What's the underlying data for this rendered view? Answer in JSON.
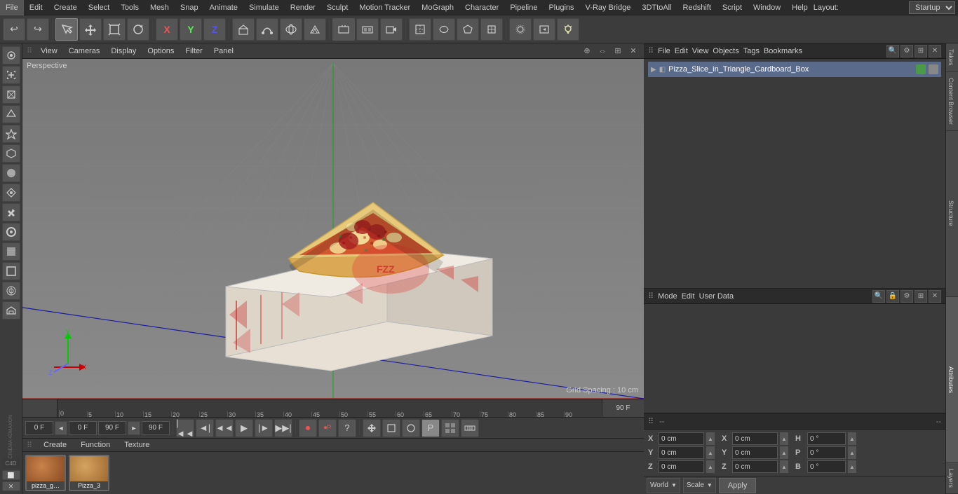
{
  "menubar": {
    "items": [
      "File",
      "Edit",
      "Create",
      "Select",
      "Tools",
      "Mesh",
      "Snap",
      "Animate",
      "Simulate",
      "Render",
      "Sculpt",
      "Motion Tracker",
      "MoGraph",
      "Character",
      "Pipeline",
      "Plugins",
      "V-Ray Bridge",
      "3DTtoAll",
      "Redshift",
      "Script",
      "Window",
      "Help"
    ],
    "layout_label": "Layout:",
    "layout_value": "Startup"
  },
  "toolbar": {
    "undo_icon": "↩",
    "redo_icon": "↪",
    "move_icon": "✛",
    "scale_icon": "⊡",
    "rotate_icon": "↻",
    "axis_x": "X",
    "axis_y": "Y",
    "axis_z": "Z",
    "record_icon": "⏺",
    "play_icon": "▶",
    "camera_icon": "📷"
  },
  "viewport": {
    "label": "Perspective",
    "menus": [
      "View",
      "Cameras",
      "Display",
      "Options",
      "Filter",
      "Panel"
    ],
    "grid_spacing": "Grid Spacing : 10 cm"
  },
  "object_manager": {
    "title_icon": "⊞",
    "menus": [
      "File",
      "Edit",
      "View",
      "Objects",
      "Tags",
      "Bookmarks"
    ],
    "object_name": "Pizza_Slice_in_Triangle_Cardboard_Box",
    "object_tag_color": "#4a9a4a"
  },
  "attr_manager": {
    "menus": [
      "Mode",
      "Edit",
      "User Data"
    ],
    "dash1": "--",
    "dash2": "--"
  },
  "coordinates": {
    "x_pos": "0 cm",
    "y_pos": "0 cm",
    "z_pos": "0 cm",
    "x_rot_label": "H",
    "y_rot_label": "P",
    "z_rot_label": "B",
    "x_rot": "0 °",
    "y_rot": "0 °",
    "z_rot": "0 °",
    "size_x_label": "X",
    "size_y_label": "Y",
    "size_z_label": "Z",
    "size_x": "0 cm",
    "size_y": "0 cm",
    "size_z": "0 cm",
    "world_label": "World",
    "scale_label": "Scale",
    "apply_label": "Apply"
  },
  "timeline": {
    "frames": [
      "0",
      "5",
      "10",
      "15",
      "20",
      "25",
      "30",
      "35",
      "40",
      "45",
      "50",
      "55",
      "60",
      "65",
      "70",
      "75",
      "80",
      "85",
      "90"
    ],
    "current": "0 F",
    "end": "90 F",
    "start_field": "0 F",
    "preview_start": "0 F",
    "preview_end": "90 F"
  },
  "materials": {
    "menus": [
      "Create",
      "Function",
      "Texture"
    ],
    "items": [
      {
        "label": "pizza_g…"
      },
      {
        "label": "Pizza_3"
      }
    ]
  },
  "side_tools": {
    "icons": [
      "◎",
      "✦",
      "⬡",
      "△",
      "☆",
      "⬢",
      "⬤",
      "⌂",
      "✂",
      "◉",
      "⬛",
      "⬜",
      "⊙",
      "✦"
    ]
  },
  "right_tabs": {
    "takes": "Takes",
    "content_browser": "Content Browser",
    "structure": "Structure",
    "attributes": "Attributes",
    "layers": "Layers"
  },
  "bottom_icons": {
    "c4d": "C4D",
    "screen": "⬜",
    "close": "✕"
  },
  "playback": {
    "start_frame": "0 F",
    "end_frame": "90 F",
    "preview_start": "0 F",
    "preview_end": "90 F",
    "current_frame": "0 F"
  }
}
